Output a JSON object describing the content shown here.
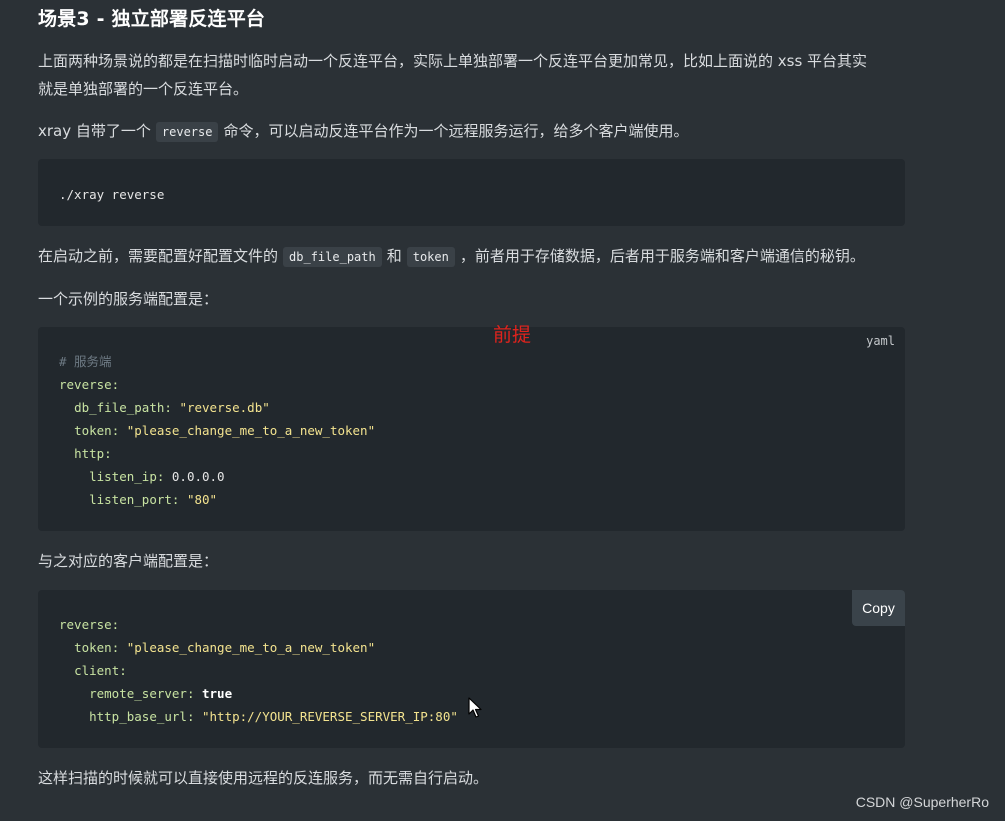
{
  "heading": "场景3 - 独立部署反连平台",
  "para1": "上面两种场景说的都是在扫描时临时启动一个反连平台，实际上单独部署一个反连平台更加常见，比如上面说的 xss 平台其实就是单独部署的一个反连平台。",
  "para1_line1": "上面两种场景说的都是在扫描时临时启动一个反连平台，实际上单独部署一个反连平台更加常见，比如上面说的 xss 平台其实",
  "para1_line2": "就是单独部署的一个反连平台。",
  "para2": {
    "before": "xray 自带了一个",
    "code": "reverse",
    "after": "命令，可以启动反连平台作为一个远程服务运行，给多个客户端使用。"
  },
  "code1": "./xray reverse",
  "para3": {
    "before": "在启动之前，需要配置好配置文件的",
    "code1": "db_file_path",
    "mid": "和",
    "code2": "token",
    "after": "，前者用于存储数据，后者用于服务端和客户端通信的秘钥。"
  },
  "para4": "一个示例的服务端配置是：",
  "server_config": {
    "lang": "yaml",
    "comment": "# 服务端",
    "reverse_key": "reverse:",
    "db_key": "db_file_path:",
    "db_val": "\"reverse.db\"",
    "token_key": "token:",
    "token_val": "\"please_change_me_to_a_new_token\"",
    "http_key": "http:",
    "ip_key": "listen_ip:",
    "ip_val": "0.0.0.0",
    "port_key": "listen_port:",
    "port_val": "\"80\""
  },
  "annotation": "前提",
  "para5": "与之对应的客户端配置是：",
  "client_config": {
    "copy_label": "Copy",
    "reverse_key": "reverse:",
    "token_key": "token:",
    "token_val": "\"please_change_me_to_a_new_token\"",
    "client_key": "client:",
    "remote_key": "remote_server:",
    "remote_val": "true",
    "url_key": "http_base_url:",
    "url_val": "\"http://YOUR_REVERSE_SERVER_IP:80\""
  },
  "para6": "这样扫描的时候就可以直接使用远程的反连服务，而无需自行启动。",
  "watermark": "CSDN @SuperherRo"
}
